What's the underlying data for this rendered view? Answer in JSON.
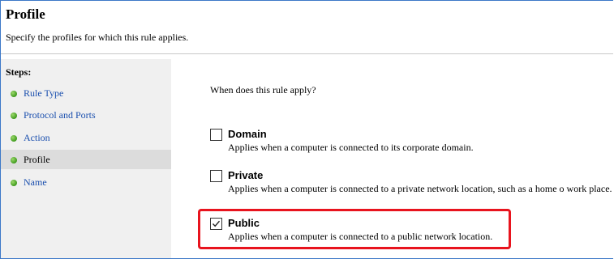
{
  "header": {
    "title": "Profile",
    "subtitle": "Specify the profiles for which this rule applies."
  },
  "steps": {
    "heading": "Steps:",
    "items": [
      {
        "label": "Rule Type",
        "selected": false
      },
      {
        "label": "Protocol and Ports",
        "selected": false
      },
      {
        "label": "Action",
        "selected": false
      },
      {
        "label": "Profile",
        "selected": true
      },
      {
        "label": "Name",
        "selected": false
      }
    ]
  },
  "content": {
    "question": "When does this rule apply?",
    "options": {
      "domain": {
        "title": "Domain",
        "description": "Applies when a computer is connected to its corporate domain.",
        "checked": false
      },
      "private": {
        "title": "Private",
        "description": "Applies when a computer is connected to a private network location, such as a home o work place.",
        "checked": false
      },
      "public": {
        "title": "Public",
        "description": "Applies when a computer is connected to a public network location.",
        "checked": true
      }
    }
  },
  "colors": {
    "highlight": "#e8141e",
    "window_border": "#3c78c8",
    "step_link": "#1a4fae",
    "step_dot": "#3f9b1e"
  }
}
